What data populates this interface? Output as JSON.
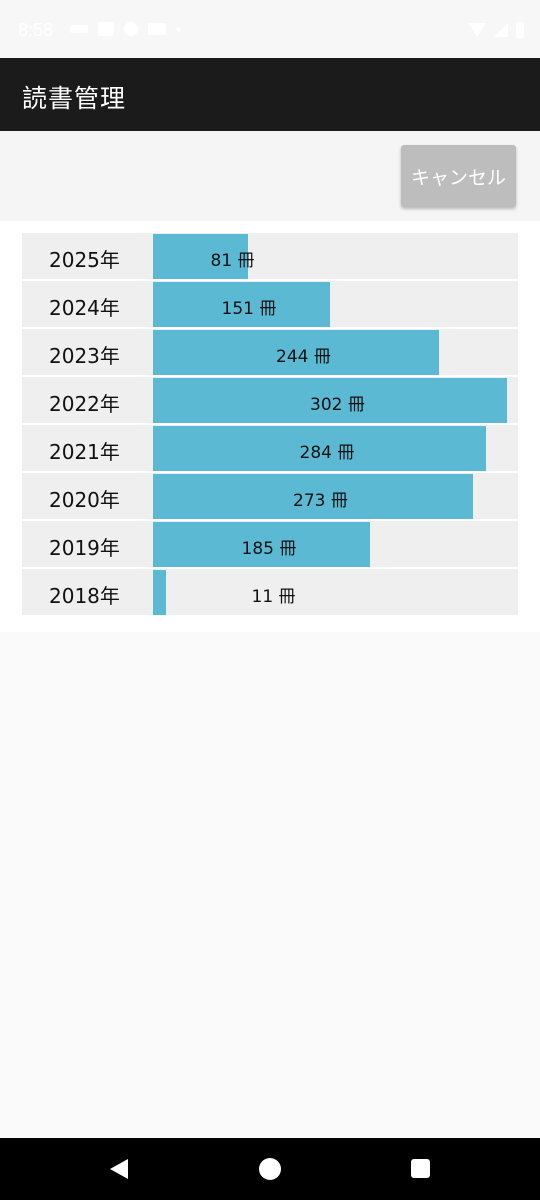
{
  "status_bar": {
    "time": "8:58",
    "left_icons": [
      "battery-saver-icon",
      "notification-icon",
      "sync-off-icon",
      "data-icon",
      "dot-icon"
    ],
    "right_icons": [
      "wifi-icon",
      "signal-icon",
      "battery-icon"
    ]
  },
  "app_bar": {
    "title": "読書管理"
  },
  "actions": {
    "cancel_label": "キャンセル"
  },
  "colors": {
    "bar": "#5bb9d4",
    "row_bg": "#efefef",
    "app_bar": "#1b1b1b",
    "cancel_bg": "#bdbdbd"
  },
  "chart_data": {
    "type": "bar",
    "orientation": "horizontal",
    "categories": [
      "2025年",
      "2024年",
      "2023年",
      "2022年",
      "2021年",
      "2020年",
      "2019年",
      "2018年"
    ],
    "values": [
      81,
      151,
      244,
      302,
      284,
      273,
      185,
      11
    ],
    "value_labels": [
      "81 冊",
      "151 冊",
      "244 冊",
      "302 冊",
      "284 冊",
      "273 冊",
      "185 冊",
      "11 冊"
    ]
  },
  "nav_bar": {
    "icons": [
      "back-icon",
      "home-icon",
      "recents-icon"
    ]
  }
}
